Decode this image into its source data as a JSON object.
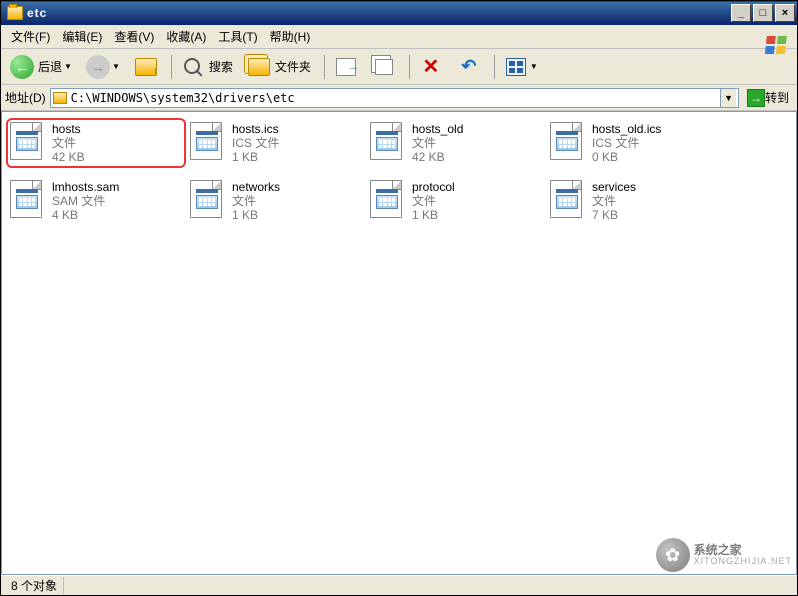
{
  "window": {
    "title": "etc"
  },
  "menu": {
    "file": "文件(F)",
    "edit": "编辑(E)",
    "view": "查看(V)",
    "favorites": "收藏(A)",
    "tools": "工具(T)",
    "help": "帮助(H)"
  },
  "toolbar": {
    "back": "后退",
    "search": "搜索",
    "folders": "文件夹"
  },
  "address": {
    "label": "地址(D)",
    "path": "C:\\WINDOWS\\system32\\drivers\\etc",
    "go": "转到"
  },
  "files": [
    {
      "name": "hosts",
      "desc": "文件",
      "size": "42 KB",
      "highlighted": true
    },
    {
      "name": "hosts.ics",
      "desc": "ICS 文件",
      "size": "1 KB",
      "highlighted": false
    },
    {
      "name": "hosts_old",
      "desc": "文件",
      "size": "42 KB",
      "highlighted": false
    },
    {
      "name": "hosts_old.ics",
      "desc": "ICS 文件",
      "size": "0 KB",
      "highlighted": false
    },
    {
      "name": "lmhosts.sam",
      "desc": "SAM 文件",
      "size": "4 KB",
      "highlighted": false
    },
    {
      "name": "networks",
      "desc": "文件",
      "size": "1 KB",
      "highlighted": false
    },
    {
      "name": "protocol",
      "desc": "文件",
      "size": "1 KB",
      "highlighted": false
    },
    {
      "name": "services",
      "desc": "文件",
      "size": "7 KB",
      "highlighted": false
    }
  ],
  "status": {
    "objects": "8 个对象"
  },
  "watermark": {
    "name": "系统之家",
    "url": "XITONGZHIJIA.NET"
  }
}
